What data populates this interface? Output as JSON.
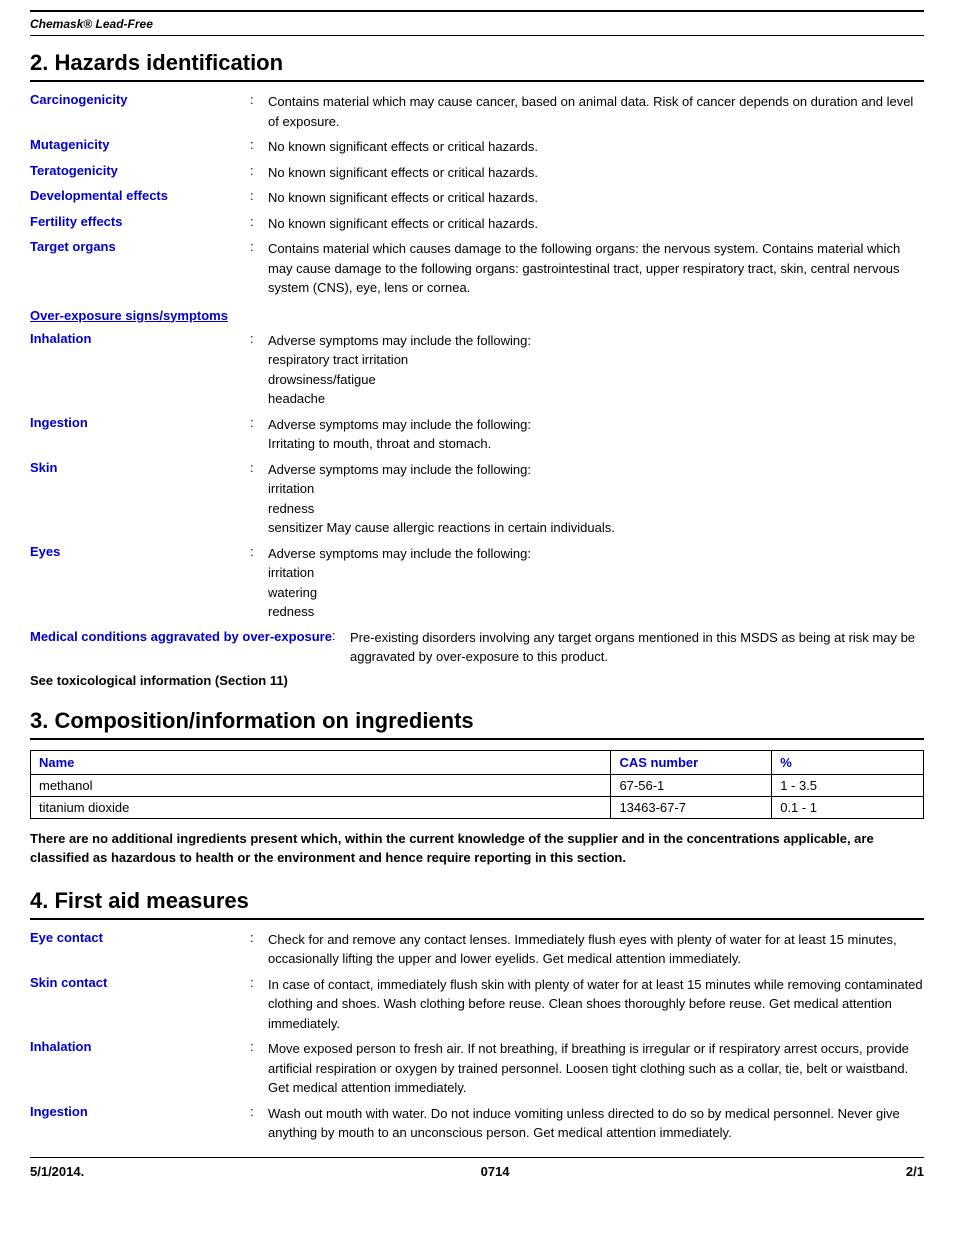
{
  "header": {
    "product": "Chemask® Lead-Free"
  },
  "section2": {
    "title": "2. Hazards identification",
    "rows": [
      {
        "label": "Carcinogenicity",
        "text": "Contains material which may cause cancer, based on animal data.  Risk of cancer depends on duration and level of exposure."
      },
      {
        "label": "Mutagenicity",
        "text": "No known significant effects or critical hazards."
      },
      {
        "label": "Teratogenicity",
        "text": "No known significant effects or critical hazards."
      },
      {
        "label": "Developmental effects",
        "text": "No known significant effects or critical hazards."
      },
      {
        "label": "Fertility effects",
        "text": "No known significant effects or critical hazards."
      },
      {
        "label": "Target organs",
        "text": "Contains material which causes damage to the following organs: the nervous system.  Contains material which may cause damage to the following organs: gastrointestinal tract, upper respiratory tract, skin, central nervous system (CNS), eye, lens or cornea."
      }
    ],
    "over_exposure_link": "Over-exposure signs/symptoms",
    "symptoms": [
      {
        "label": "Inhalation",
        "text": "Adverse symptoms may include the following:\nrespiratory tract irritation\ndrowsiness/fatigue\nheadache"
      },
      {
        "label": "Ingestion",
        "text": "Adverse symptoms may include the following:\nIrritating to mouth, throat and stomach."
      },
      {
        "label": "Skin",
        "text": "Adverse symptoms may include the following:\nirritation\nredness\nsensitizer May cause allergic reactions in certain individuals."
      },
      {
        "label": "Eyes",
        "text": "Adverse symptoms may include the following:\nirritation\nwatering\nredness"
      },
      {
        "label": "Medical conditions aggravated by over-exposure",
        "text": "Pre-existing disorders involving any target organs mentioned in this MSDS as being at risk may be aggravated by over-exposure to this product."
      }
    ],
    "see_tox": "See toxicological information (Section 11)"
  },
  "section3": {
    "title": "3. Composition/information on ingredients",
    "columns": [
      "Name",
      "CAS number",
      "%"
    ],
    "ingredients": [
      {
        "name": "methanol",
        "cas": "67-56-1",
        "pct": "1 - 3.5"
      },
      {
        "name": "titanium dioxide",
        "cas": "13463-67-7",
        "pct": "0.1 - 1"
      }
    ],
    "note": "There are no additional ingredients present which, within the current knowledge of the supplier and in the concentrations applicable, are classified as hazardous to health or the environment and hence require reporting in this section."
  },
  "section4": {
    "title": "4. First aid measures",
    "rows": [
      {
        "label": "Eye contact",
        "text": "Check for and remove any contact lenses.  Immediately flush eyes with plenty of water for at least 15 minutes, occasionally lifting the upper and lower eyelids.  Get medical attention immediately."
      },
      {
        "label": "Skin contact",
        "text": "In case of contact, immediately flush skin with plenty of water for at least 15 minutes while removing contaminated clothing and shoes.  Wash clothing before reuse.  Clean shoes thoroughly before reuse.  Get medical attention immediately."
      },
      {
        "label": "Inhalation",
        "text": "Move exposed person to fresh air.  If not breathing, if breathing is irregular or if respiratory arrest occurs, provide artificial respiration or oxygen by trained personnel.  Loosen tight clothing such as a collar, tie, belt or waistband.  Get medical attention immediately."
      },
      {
        "label": "Ingestion",
        "text": "Wash out mouth with water.  Do not induce vomiting unless directed to do so by medical personnel.  Never give anything by mouth to an unconscious person.  Get medical attention immediately."
      }
    ]
  },
  "footer": {
    "date": "5/1/2014.",
    "code": "0714",
    "page": "2/1"
  }
}
